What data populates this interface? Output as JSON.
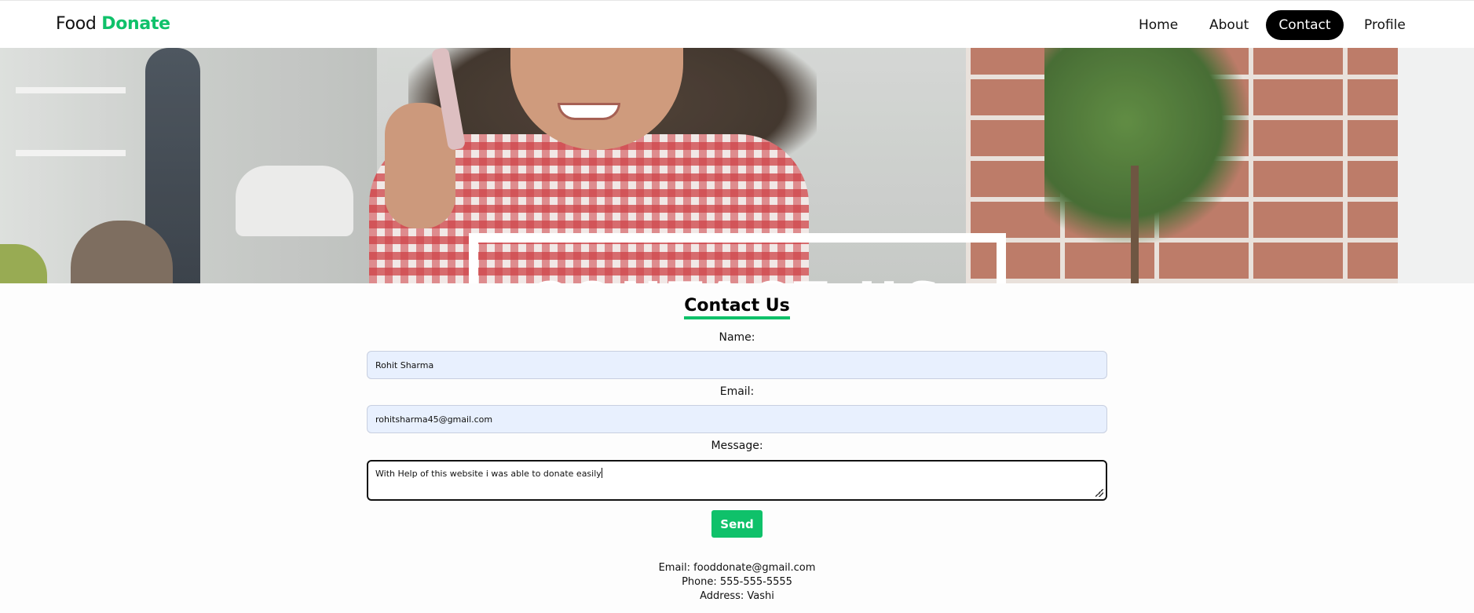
{
  "navbar": {
    "logo_first": "Food",
    "logo_second": "Donate",
    "links": [
      {
        "label": "Home"
      },
      {
        "label": "About"
      },
      {
        "label": "Contact",
        "active": true
      },
      {
        "label": "Profile"
      }
    ]
  },
  "hero": {
    "title": "CONTACT US"
  },
  "form": {
    "title": "Contact Us",
    "name_label": "Name:",
    "name_value": "Rohit Sharma",
    "email_label": "Email:",
    "email_value": "rohitsharma45@gmail.com",
    "message_label": "Message:",
    "message_value": "With Help of this website i was able to donate easily",
    "send_label": "Send"
  },
  "contact_info": {
    "email": "Email: fooddonate@gmail.com",
    "phone": "Phone: 555-555-5555",
    "address": "Address: Vashi"
  },
  "colors": {
    "accent": "#0fc16a",
    "nav_active_bg": "#000000",
    "input_bg": "#e8f0fe"
  }
}
